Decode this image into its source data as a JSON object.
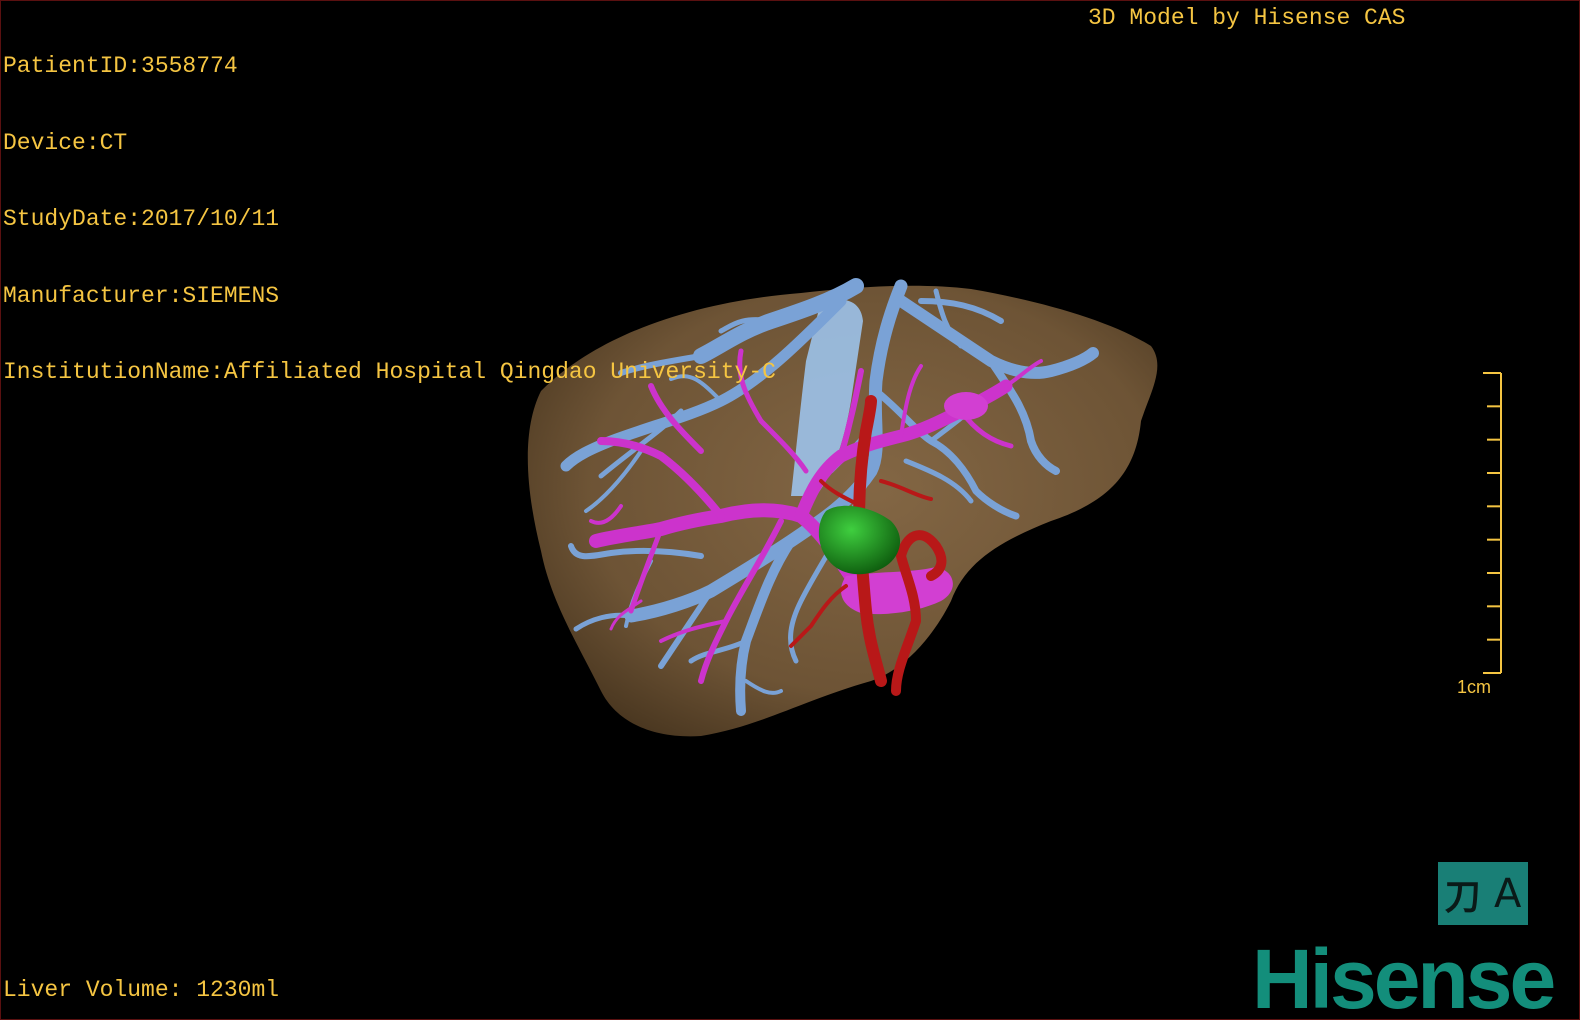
{
  "info": {
    "patient_id": "PatientID:3558774",
    "device": "Device:CT",
    "study_date": "StudyDate:2017/10/11",
    "manufacturer": "Manufacturer:SIEMENS",
    "institution": "InstitutionName:Affiliated Hospital Qingdao University-C"
  },
  "brand_top": "3D Model by Hisense CAS",
  "footer": {
    "liver_volume": "Liver Volume: 1230ml"
  },
  "scale_bar": {
    "label": "1cm",
    "ticks": 10
  },
  "toolbar": {
    "glyph_left": "刀",
    "glyph_right": "A",
    "button_icon": "cut-annotate-icon"
  },
  "logo": {
    "text": "Hisense"
  },
  "colors": {
    "overlay_text": "#f5c542",
    "liver": "#7a5e3c",
    "hepatic_vein": "#7aa2d6",
    "portal_vein": "#cc33cc",
    "artery": "#b81818",
    "tumor": "#1f8a1f",
    "logo": "#138e7b",
    "tool_button": "#197f76"
  }
}
